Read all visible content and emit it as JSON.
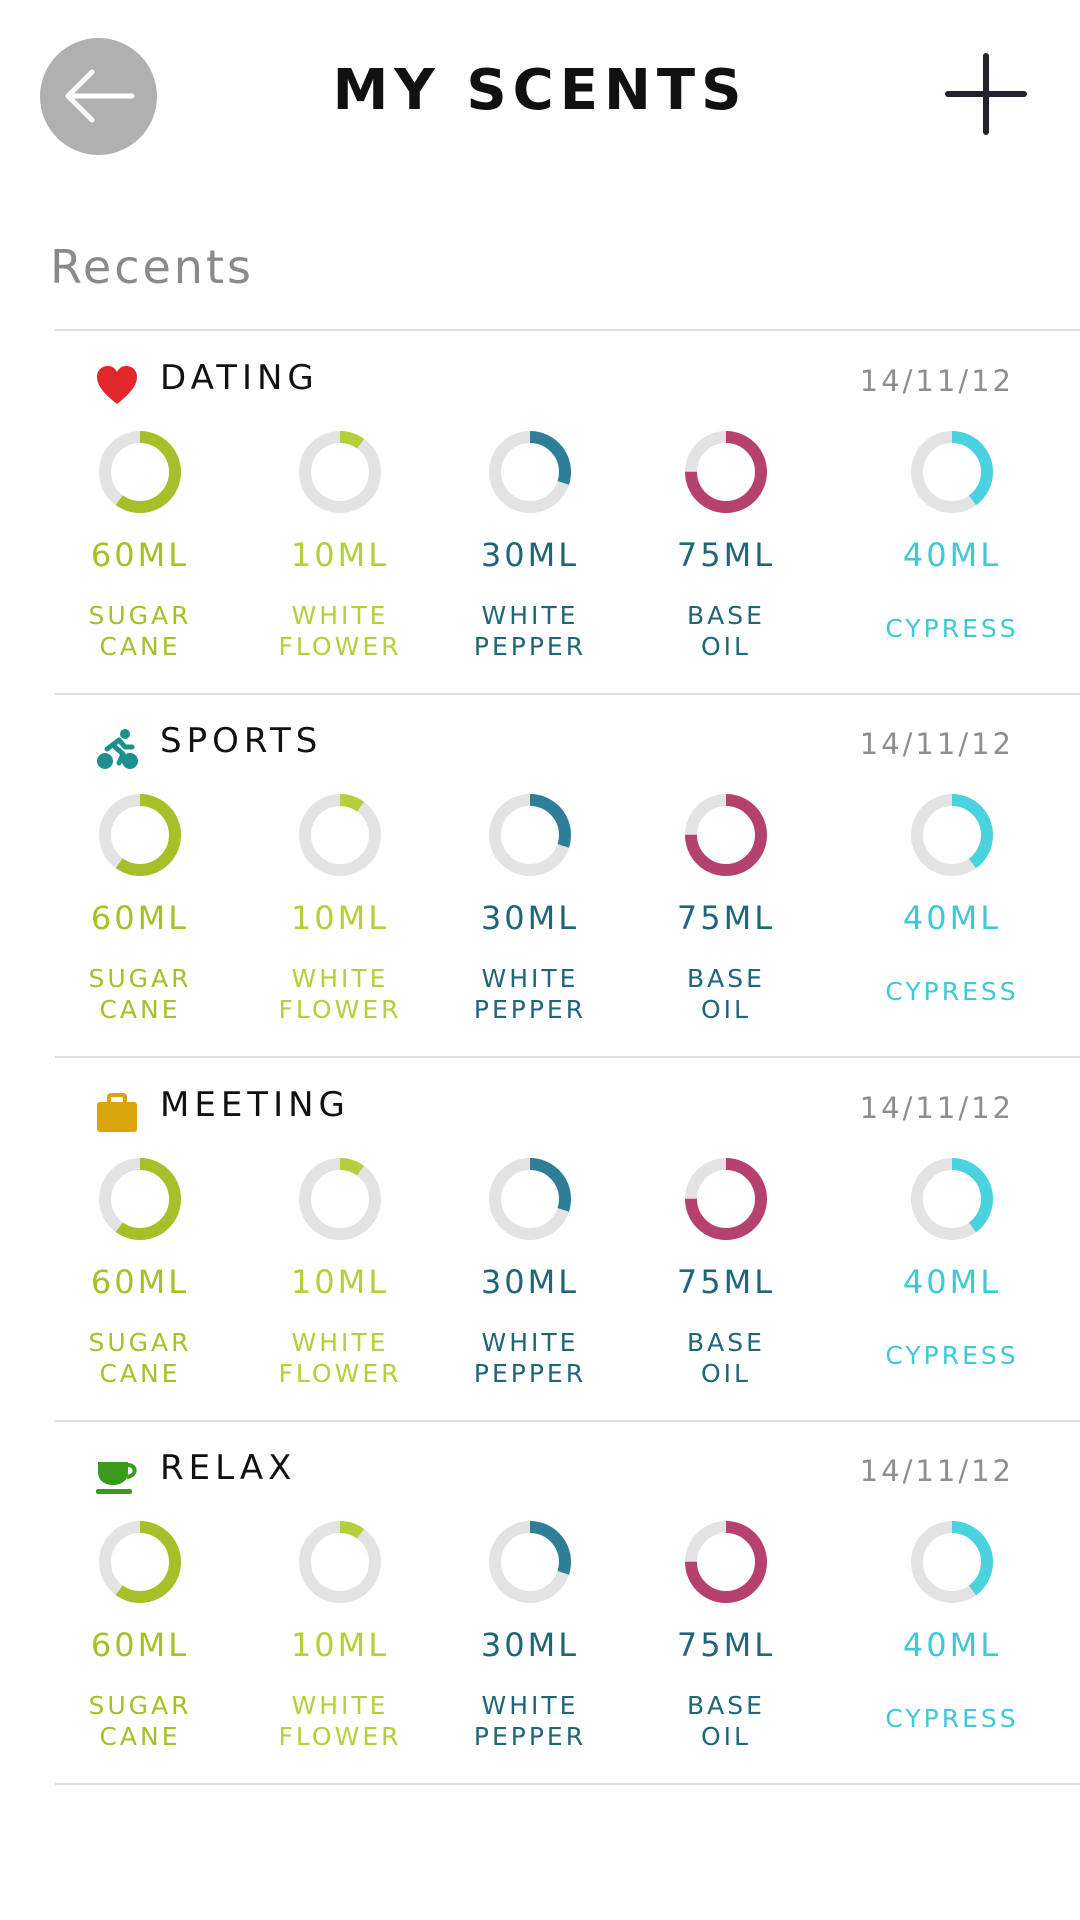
{
  "header": {
    "title": "MY SCENTS",
    "back_icon": "arrow-left-icon",
    "add_icon": "plus-icon"
  },
  "section_title": "Recents",
  "colors": {
    "ring_track": "#e3e3e3",
    "back_button": "#b0b0b0",
    "sugar_cane": "#a6c02a",
    "white_flower": "#b3d03c",
    "white_pepper": "#2f7e98",
    "base_oil": "#b6406e",
    "cypress": "#4bd2df"
  },
  "scents": [
    {
      "name": "DATING",
      "date": "14/11/12",
      "icon": "heart-icon",
      "icon_color": "#e0282c",
      "ingredients": [
        {
          "amount": "60ML",
          "line1": "SUGAR",
          "line2": "CANE",
          "fill": 0.6,
          "color": "#a6c02a",
          "amount_color": "#a6c02a",
          "name_color": "#a6c02a"
        },
        {
          "amount": "10ML",
          "line1": "WHITE",
          "line2": "FLOWER",
          "fill": 0.1,
          "color": "#b3d03c",
          "amount_color": "#b3d03c",
          "name_color": "#b3d03c"
        },
        {
          "amount": "30ML",
          "line1": "WHITE",
          "line2": "PEPPER",
          "fill": 0.3,
          "color": "#2f7e98",
          "amount_color": "#1f6679",
          "name_color": "#1f6679"
        },
        {
          "amount": "75ML",
          "line1": "BASE",
          "line2": "OIL",
          "fill": 0.75,
          "color": "#b6406e",
          "amount_color": "#1f6679",
          "name_color": "#1f6679"
        },
        {
          "amount": "40ML",
          "line1": "CYPRESS",
          "line2": "",
          "fill": 0.4,
          "color": "#4bd2df",
          "amount_color": "#3ec9d6",
          "name_color": "#3ec9d6"
        }
      ]
    },
    {
      "name": "SPORTS",
      "date": "14/11/12",
      "icon": "cyclist-icon",
      "icon_color": "#1c8f91",
      "ingredients": [
        {
          "amount": "60ML",
          "line1": "SUGAR",
          "line2": "CANE",
          "fill": 0.6,
          "color": "#a6c02a",
          "amount_color": "#a6c02a",
          "name_color": "#a6c02a"
        },
        {
          "amount": "10ML",
          "line1": "WHITE",
          "line2": "FLOWER",
          "fill": 0.1,
          "color": "#b3d03c",
          "amount_color": "#b3d03c",
          "name_color": "#b3d03c"
        },
        {
          "amount": "30ML",
          "line1": "WHITE",
          "line2": "PEPPER",
          "fill": 0.3,
          "color": "#2f7e98",
          "amount_color": "#1f6679",
          "name_color": "#1f6679"
        },
        {
          "amount": "75ML",
          "line1": "BASE",
          "line2": "OIL",
          "fill": 0.75,
          "color": "#b6406e",
          "amount_color": "#1f6679",
          "name_color": "#1f6679"
        },
        {
          "amount": "40ML",
          "line1": "CYPRESS",
          "line2": "",
          "fill": 0.4,
          "color": "#4bd2df",
          "amount_color": "#3ec9d6",
          "name_color": "#3ec9d6"
        }
      ]
    },
    {
      "name": "MEETING",
      "date": "14/11/12",
      "icon": "briefcase-icon",
      "icon_color": "#d9a40c",
      "ingredients": [
        {
          "amount": "60ML",
          "line1": "SUGAR",
          "line2": "CANE",
          "fill": 0.6,
          "color": "#a6c02a",
          "amount_color": "#a6c02a",
          "name_color": "#a6c02a"
        },
        {
          "amount": "10ML",
          "line1": "WHITE",
          "line2": "FLOWER",
          "fill": 0.1,
          "color": "#b3d03c",
          "amount_color": "#b3d03c",
          "name_color": "#b3d03c"
        },
        {
          "amount": "30ML",
          "line1": "WHITE",
          "line2": "PEPPER",
          "fill": 0.3,
          "color": "#2f7e98",
          "amount_color": "#1f6679",
          "name_color": "#1f6679"
        },
        {
          "amount": "75ML",
          "line1": "BASE",
          "line2": "OIL",
          "fill": 0.75,
          "color": "#b6406e",
          "amount_color": "#1f6679",
          "name_color": "#1f6679"
        },
        {
          "amount": "40ML",
          "line1": "CYPRESS",
          "line2": "",
          "fill": 0.4,
          "color": "#4bd2df",
          "amount_color": "#3ec9d6",
          "name_color": "#3ec9d6"
        }
      ]
    },
    {
      "name": "RELAX",
      "date": "14/11/12",
      "icon": "teacup-icon",
      "icon_color": "#3a9a1c",
      "ingredients": [
        {
          "amount": "60ML",
          "line1": "SUGAR",
          "line2": "CANE",
          "fill": 0.6,
          "color": "#a6c02a",
          "amount_color": "#a6c02a",
          "name_color": "#a6c02a"
        },
        {
          "amount": "10ML",
          "line1": "WHITE",
          "line2": "FLOWER",
          "fill": 0.1,
          "color": "#b3d03c",
          "amount_color": "#b3d03c",
          "name_color": "#b3d03c"
        },
        {
          "amount": "30ML",
          "line1": "WHITE",
          "line2": "PEPPER",
          "fill": 0.3,
          "color": "#2f7e98",
          "amount_color": "#1f6679",
          "name_color": "#1f6679"
        },
        {
          "amount": "75ML",
          "line1": "BASE",
          "line2": "OIL",
          "fill": 0.75,
          "color": "#b6406e",
          "amount_color": "#1f6679",
          "name_color": "#1f6679"
        },
        {
          "amount": "40ML",
          "line1": "CYPRESS",
          "line2": "",
          "fill": 0.4,
          "color": "#4bd2df",
          "amount_color": "#3ec9d6",
          "name_color": "#3ec9d6"
        }
      ]
    }
  ]
}
